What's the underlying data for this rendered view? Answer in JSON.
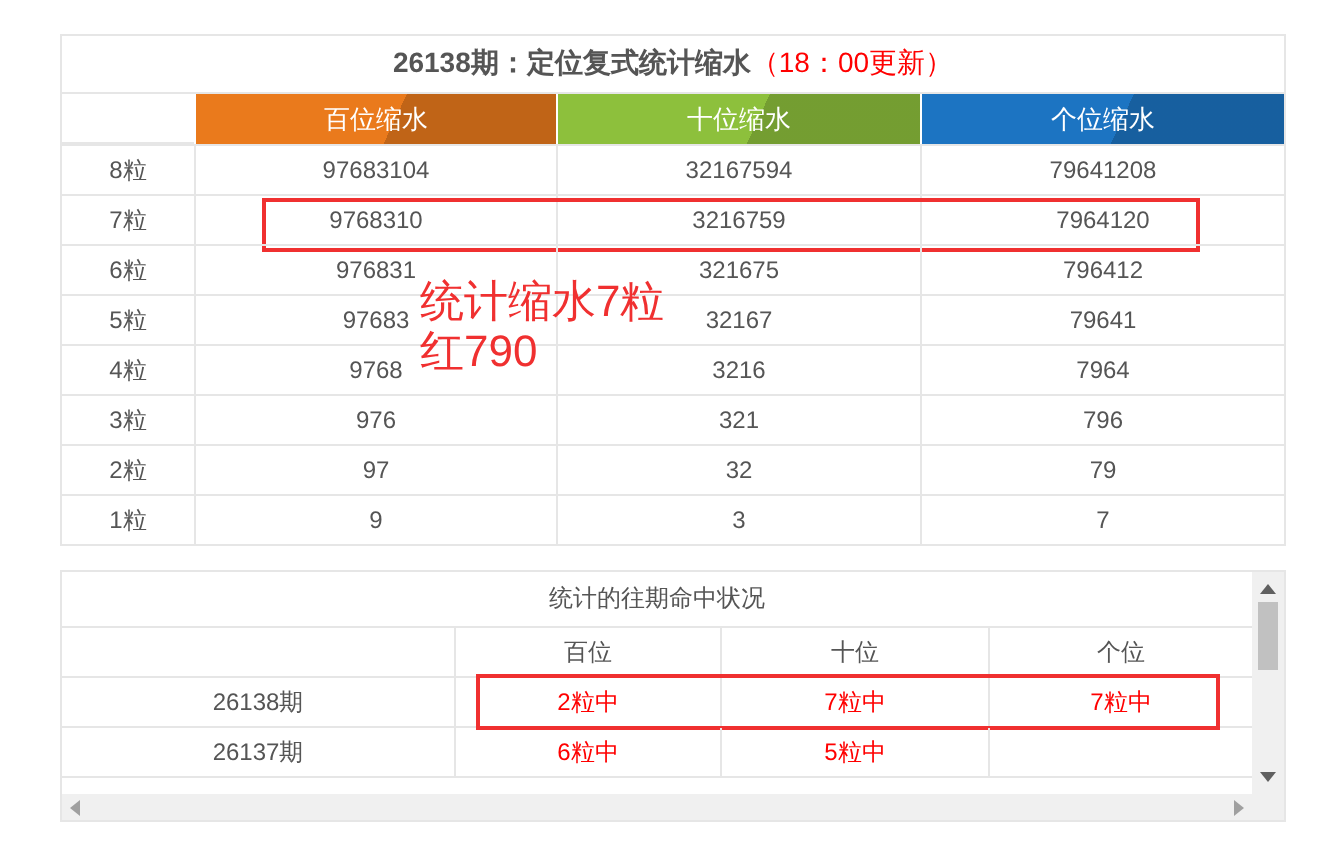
{
  "table": {
    "title": "26138期：定位复式统计缩水",
    "update_note": "（18：00更新）",
    "columns": [
      {
        "label": "百位缩水",
        "color": "#ea7a1c"
      },
      {
        "label": "十位缩水",
        "color": "#8dc03c"
      },
      {
        "label": "个位缩水",
        "color": "#1c74c2"
      }
    ],
    "rows": [
      {
        "label": "8粒",
        "values": [
          "97683104",
          "32167594",
          "79641208"
        ],
        "highlighted": false
      },
      {
        "label": "7粒",
        "values": [
          "9768310",
          "3216759",
          "7964120"
        ],
        "highlighted": true
      },
      {
        "label": "6粒",
        "values": [
          "976831",
          "321675",
          "796412"
        ],
        "highlighted": false
      },
      {
        "label": "5粒",
        "values": [
          "97683",
          "32167",
          "79641"
        ],
        "highlighted": false
      },
      {
        "label": "4粒",
        "values": [
          "9768",
          "3216",
          "7964"
        ],
        "highlighted": false
      },
      {
        "label": "3粒",
        "values": [
          "976",
          "321",
          "796"
        ],
        "highlighted": false
      },
      {
        "label": "2粒",
        "values": [
          "97",
          "32",
          "79"
        ],
        "highlighted": false
      },
      {
        "label": "1粒",
        "values": [
          "9",
          "3",
          "7"
        ],
        "highlighted": false
      }
    ]
  },
  "annotation": {
    "text": "统计缩水7粒红790"
  },
  "history": {
    "title": "统计的往期命中状况",
    "columns": [
      "百位",
      "十位",
      "个位"
    ],
    "rows": [
      {
        "period": "26138期",
        "hits": [
          "2粒中",
          "7粒中",
          "7粒中"
        ],
        "highlighted": true
      },
      {
        "period": "26137期",
        "hits": [
          "6粒中",
          "5粒中"
        ],
        "highlighted": false
      }
    ]
  }
}
